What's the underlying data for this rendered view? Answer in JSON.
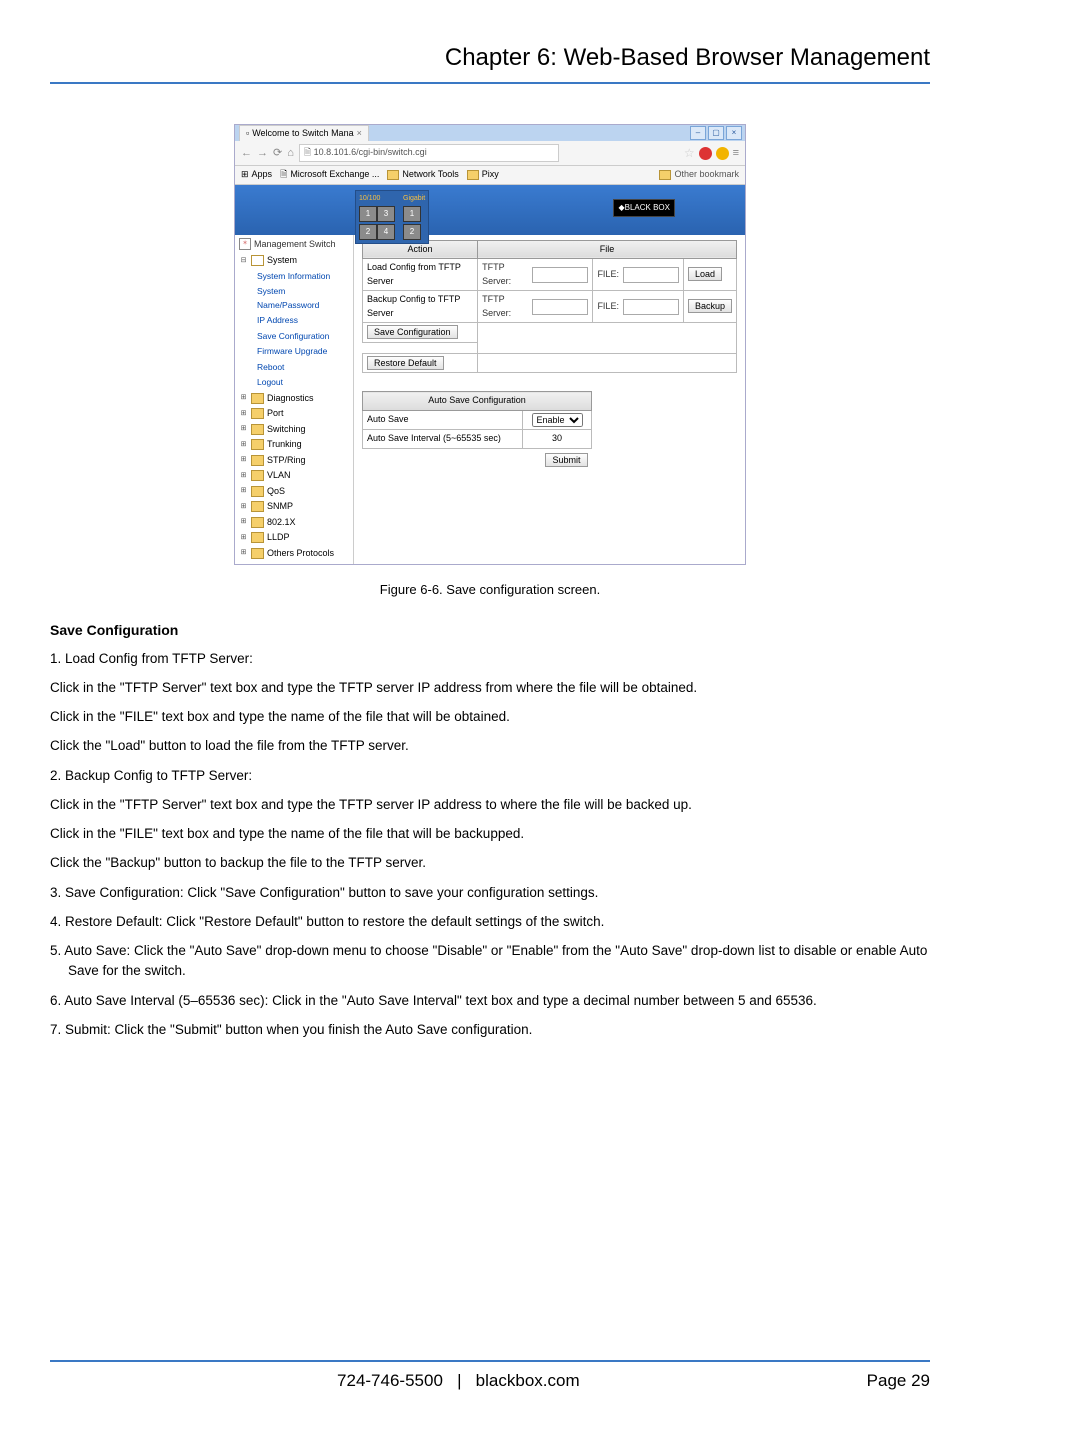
{
  "chapter_title": "Chapter 6: Web-Based Browser Management",
  "caption": "Figure 6-6. Save configuration screen.",
  "section_heading": "Save Configuration",
  "paragraphs": {
    "p1": "1. Load Config from TFTP Server:",
    "p2": "Click in the \"TFTP Server\" text box and type the TFTP server IP address from where the file will be obtained.",
    "p3": "Click in the \"FILE\" text box and type the name of the file that will be obtained.",
    "p4": "Click the \"Load\" button to load the file from the TFTP server.",
    "p5": "2. Backup Config to TFTP Server:",
    "p6": "Click in the \"TFTP Server\" text box and type the TFTP server IP address to where the file will be backed up.",
    "p7": "Click in the \"FILE\" text box and type the name of the file that will be backupped.",
    "p8": "Click the \"Backup\" button to backup the file to the TFTP server.",
    "p9": "3. Save Configuration: Click \"Save Configuration\" button to save your configuration settings.",
    "p10": "4. Restore Default: Click \"Restore Default\" button to restore the default settings of the switch.",
    "p11": "5. Auto Save: Click the \"Auto Save\" drop-down menu to choose \"Disable\" or \"Enable\" from the \"Auto Save\" drop-down list to disable or enable Auto Save for the switch.",
    "p12": "6. Auto Save Interval (5–65536 sec): Click in the \"Auto Save Interval\" text box and type a decimal number between 5 and 65536.",
    "p13": "7. Submit: Click the \"Submit\" button when you finish the Auto Save configuration."
  },
  "footer": {
    "phone": "724-746-5500",
    "sep": "|",
    "site": "blackbox.com",
    "page": "Page 29"
  },
  "browser": {
    "tab_title": "Welcome to Switch Mana",
    "url": "10.8.101.6/cgi-bin/switch.cgi",
    "bookmarks": {
      "apps": "Apps",
      "b1": "Microsoft Exchange ...",
      "b2": "Network Tools",
      "b3": "Pixy",
      "other": "Other bookmark"
    }
  },
  "ports": {
    "group1": {
      "label": "10/100",
      "p": [
        "1",
        "3",
        "2",
        "4"
      ]
    },
    "group2": {
      "label": "Gigabit",
      "p": [
        "1",
        "2"
      ]
    }
  },
  "brand": "◆BLACK BOX",
  "tree": {
    "root": "Management Switch",
    "system": "System",
    "children": [
      "System Information",
      "System Name/Password",
      "IP Address",
      "Save Configuration",
      "Firmware Upgrade",
      "Reboot",
      "Logout"
    ],
    "folders": [
      "Diagnostics",
      "Port",
      "Switching",
      "Trunking",
      "STP/Ring",
      "VLAN",
      "QoS",
      "SNMP",
      "802.1X",
      "LLDP",
      "Others Protocols"
    ]
  },
  "tbl1": {
    "h1": "Action",
    "h2": "File",
    "r1a": "Load Config from TFTP Server",
    "r1b1": "TFTP Server:",
    "r1b2": "FILE:",
    "r1btn": "Load",
    "r2a": "Backup Config to TFTP Server",
    "r2b1": "TFTP Server:",
    "r2b2": "FILE:",
    "r2btn": "Backup",
    "r3btn": "Save Configuration",
    "r4btn": "Restore Default"
  },
  "tbl2": {
    "header": "Auto Save Configuration",
    "r1a": "Auto Save",
    "r1b": "Enable",
    "r2a": "Auto Save Interval (5~65535 sec)",
    "r2b": "30",
    "submit": "Submit"
  }
}
